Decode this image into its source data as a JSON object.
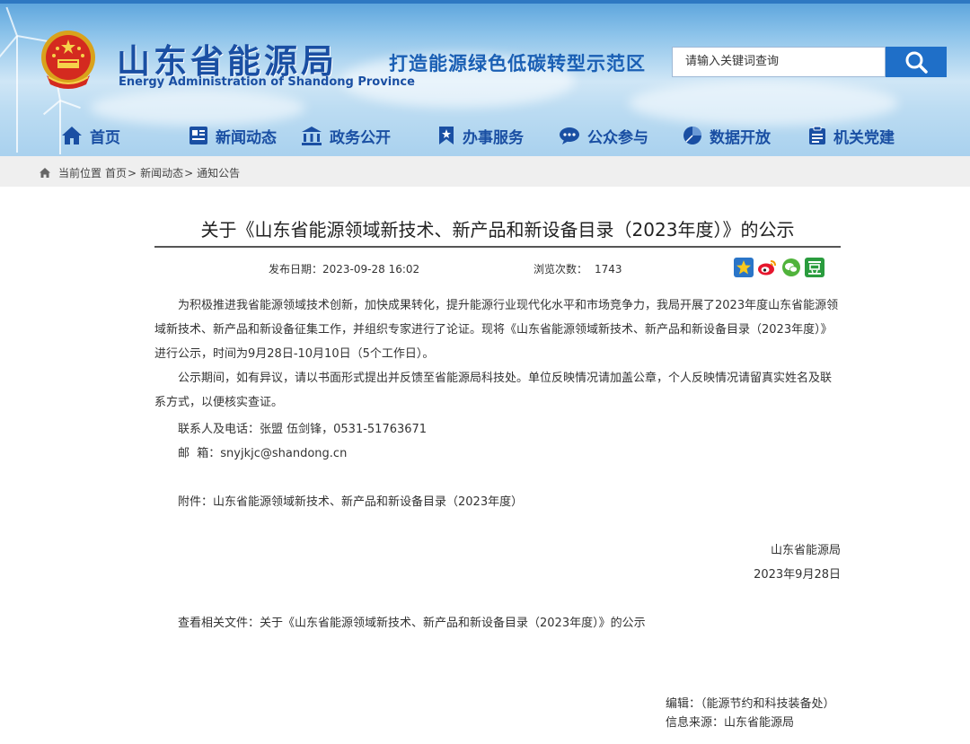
{
  "header": {
    "title": "山东省能源局",
    "subtitle": "Energy Administration of Shandong Province",
    "slogan": "打造能源绿色低碳转型示范区",
    "search_placeholder": "请输入关键词查询",
    "colors": {
      "brand": "#1a4fa3",
      "accent": "#1f6fc8",
      "header_sky": "#8cc3ea"
    }
  },
  "nav": [
    {
      "label": "首页",
      "icon": "home-icon"
    },
    {
      "label": "新闻动态",
      "icon": "news-icon"
    },
    {
      "label": "政务公开",
      "icon": "government-icon"
    },
    {
      "label": "办事服务",
      "icon": "bookmark-icon"
    },
    {
      "label": "公众参与",
      "icon": "chat-icon"
    },
    {
      "label": "数据开放",
      "icon": "pie-chart-icon"
    },
    {
      "label": "机关党建",
      "icon": "clipboard-icon"
    }
  ],
  "breadcrumb": {
    "prefix": "当前位置",
    "items": [
      "首页",
      "新闻动态",
      "通知公告"
    ],
    "separator": ">"
  },
  "article": {
    "title": "关于《山东省能源领域新技术、新产品和新设备目录（2023年度）》的公示",
    "publish_label": "发布日期：",
    "publish_date": "2023-09-28 16:02",
    "views_label": "浏览次数：",
    "views": "1743",
    "share_icons": [
      "qzone-star-icon",
      "weibo-icon",
      "wechat-icon",
      "douban-icon"
    ],
    "paragraphs": [
      "为积极推进我省能源领域技术创新，加快成果转化，提升能源行业现代化水平和市场竞争力，我局开展了2023年度山东省能源领域新技术、新产品和新设备征集工作，并组织专家进行了论证。现将《山东省能源领域新技术、新产品和新设备目录（2023年度）》进行公示，时间为9月28日-10月10日（5个工作日）。",
      "公示期间，如有异议，请以书面形式提出并反馈至省能源局科技处。单位反映情况请加盖公章，个人反映情况请留真实姓名及联系方式，以便核实查证。"
    ],
    "contact": "联系人及电话：张盟 伍剑锋，0531-51763671",
    "email": "邮  箱：snyjkjc@shandong.cn",
    "attachment_label": "附件：",
    "attachment": "山东省能源领域新技术、新产品和新设备目录（2023年度）",
    "signature_org": "山东省能源局",
    "signature_date": "2023年9月28日",
    "related_label": "查看相关文件：",
    "related": "关于《山东省能源领域新技术、新产品和新设备目录（2023年度）》的公示",
    "editor": "编辑：（能源节约和科技装备处）",
    "source": "信息来源：山东省能源局"
  }
}
